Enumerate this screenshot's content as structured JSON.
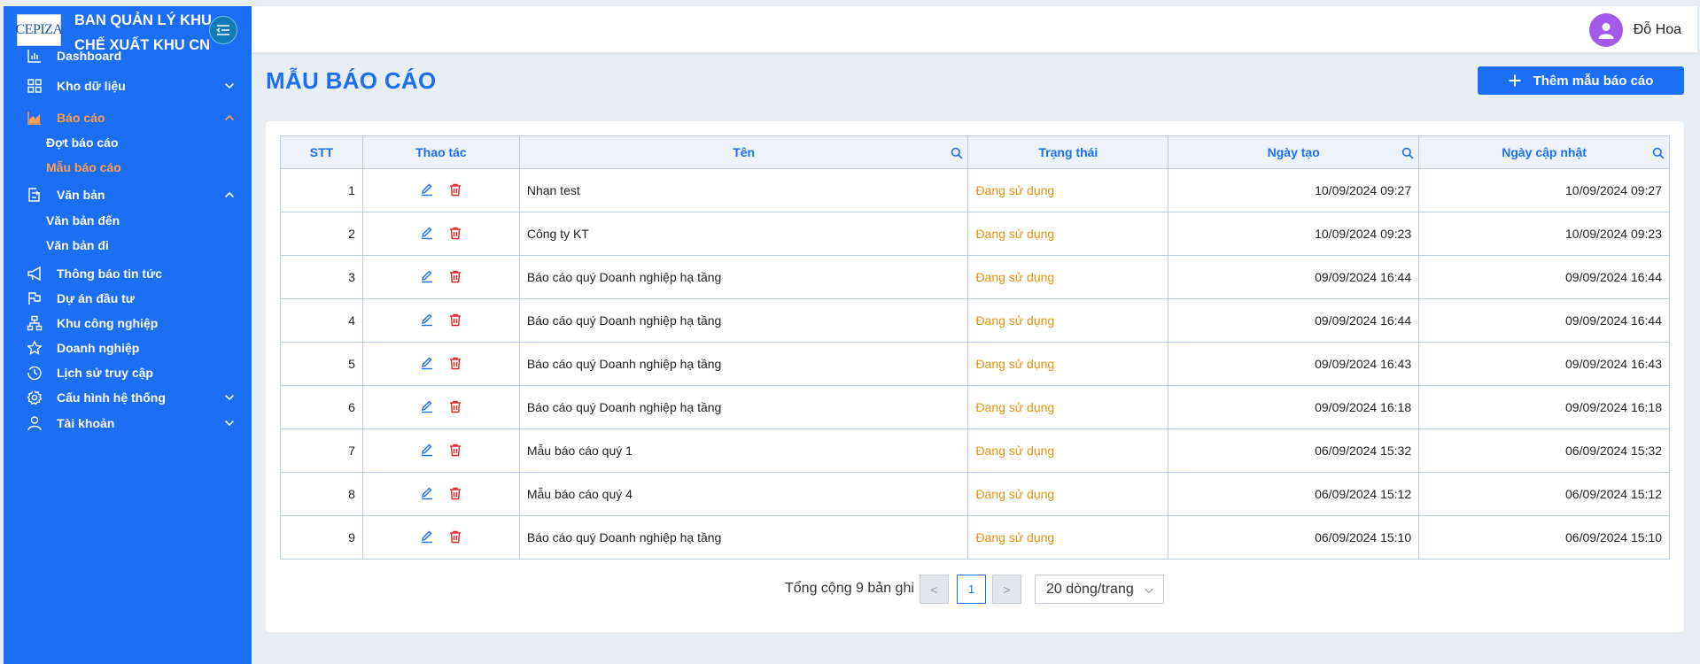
{
  "brand": {
    "logo_text": "CEPIZA",
    "title_line1": "BAN QUẢN LÝ KHU",
    "title_line2": "CHẾ XUẤT KHU CN"
  },
  "sidebar": {
    "items": [
      {
        "label": "Dashboard",
        "icon": "bar-chart-icon"
      },
      {
        "label": "Kho dữ liệu",
        "icon": "grid-icon",
        "expandable": true
      },
      {
        "label": "Báo cáo",
        "icon": "area-chart-icon",
        "expandable": true,
        "active": true,
        "children": [
          {
            "label": "Đợt báo cáo"
          },
          {
            "label": "Mẫu báo cáo",
            "active": true
          }
        ]
      },
      {
        "label": "Văn bản",
        "icon": "document-arrow-icon",
        "expandable": true,
        "children": [
          {
            "label": "Văn bản đến"
          },
          {
            "label": "Văn bản đi"
          }
        ]
      },
      {
        "label": "Thông báo tin tức",
        "icon": "megaphone-icon"
      },
      {
        "label": "Dự án đầu tư",
        "icon": "flag-icon"
      },
      {
        "label": "Khu công nghiệp",
        "icon": "org-chart-icon"
      },
      {
        "label": "Doanh nghiệp",
        "icon": "star-icon"
      },
      {
        "label": "Lịch sử truy cập",
        "icon": "history-icon"
      },
      {
        "label": "Cấu hình hệ thống",
        "icon": "gear-icon",
        "expandable": true
      },
      {
        "label": "Tài khoản",
        "icon": "user-icon",
        "expandable": true
      }
    ]
  },
  "header": {
    "user_name": "Đỗ Hoa"
  },
  "page": {
    "title": "MẪU BÁO CÁO",
    "add_button": "Thêm mẫu báo cáo"
  },
  "table": {
    "columns": [
      "STT",
      "Thao tác",
      "Tên",
      "Trạng thái",
      "Ngày tạo",
      "Ngày cập nhật"
    ],
    "rows": [
      {
        "stt": "1",
        "name": "Nhan test",
        "status": "Đang sử dụng",
        "created": "10/09/2024 09:27",
        "updated": "10/09/2024 09:27"
      },
      {
        "stt": "2",
        "name": "Công ty KT",
        "status": "Đang sử dụng",
        "created": "10/09/2024 09:23",
        "updated": "10/09/2024 09:23"
      },
      {
        "stt": "3",
        "name": "Báo cáo quý Doanh nghiệp hạ tầng",
        "status": "Đang sử dụng",
        "created": "09/09/2024 16:44",
        "updated": "09/09/2024 16:44"
      },
      {
        "stt": "4",
        "name": "Báo cáo quý Doanh nghiệp hạ tầng",
        "status": "Đang sử dụng",
        "created": "09/09/2024 16:44",
        "updated": "09/09/2024 16:44"
      },
      {
        "stt": "5",
        "name": "Báo cáo quý Doanh nghiệp hạ tầng",
        "status": "Đang sử dụng",
        "created": "09/09/2024 16:43",
        "updated": "09/09/2024 16:43"
      },
      {
        "stt": "6",
        "name": "Báo cáo quý Doanh nghiệp hạ tầng",
        "status": "Đang sử dụng",
        "created": "09/09/2024 16:18",
        "updated": "09/09/2024 16:18"
      },
      {
        "stt": "7",
        "name": "Mẫu báo cáo quý 1",
        "status": "Đang sử dụng",
        "created": "06/09/2024 15:32",
        "updated": "06/09/2024 15:32"
      },
      {
        "stt": "8",
        "name": "Mẫu báo cáo quý 4",
        "status": "Đang sử dụng",
        "created": "06/09/2024 15:12",
        "updated": "06/09/2024 15:12"
      },
      {
        "stt": "9",
        "name": "Báo cáo quý Doanh nghiệp hạ tầng",
        "status": "Đang sử dụng",
        "created": "06/09/2024 15:10",
        "updated": "06/09/2024 15:10"
      }
    ]
  },
  "pagination": {
    "total_text": "Tổng cộng 9 bản ghi",
    "prev": "<",
    "current_page": "1",
    "next": ">",
    "page_size": "20 dòng/trang"
  },
  "colors": {
    "sidebar_bg": "#1c6ef2",
    "accent": "#1c6ef2",
    "active_nav": "#ff9d4d",
    "status": "#e5930f",
    "delete": "#e02424"
  }
}
